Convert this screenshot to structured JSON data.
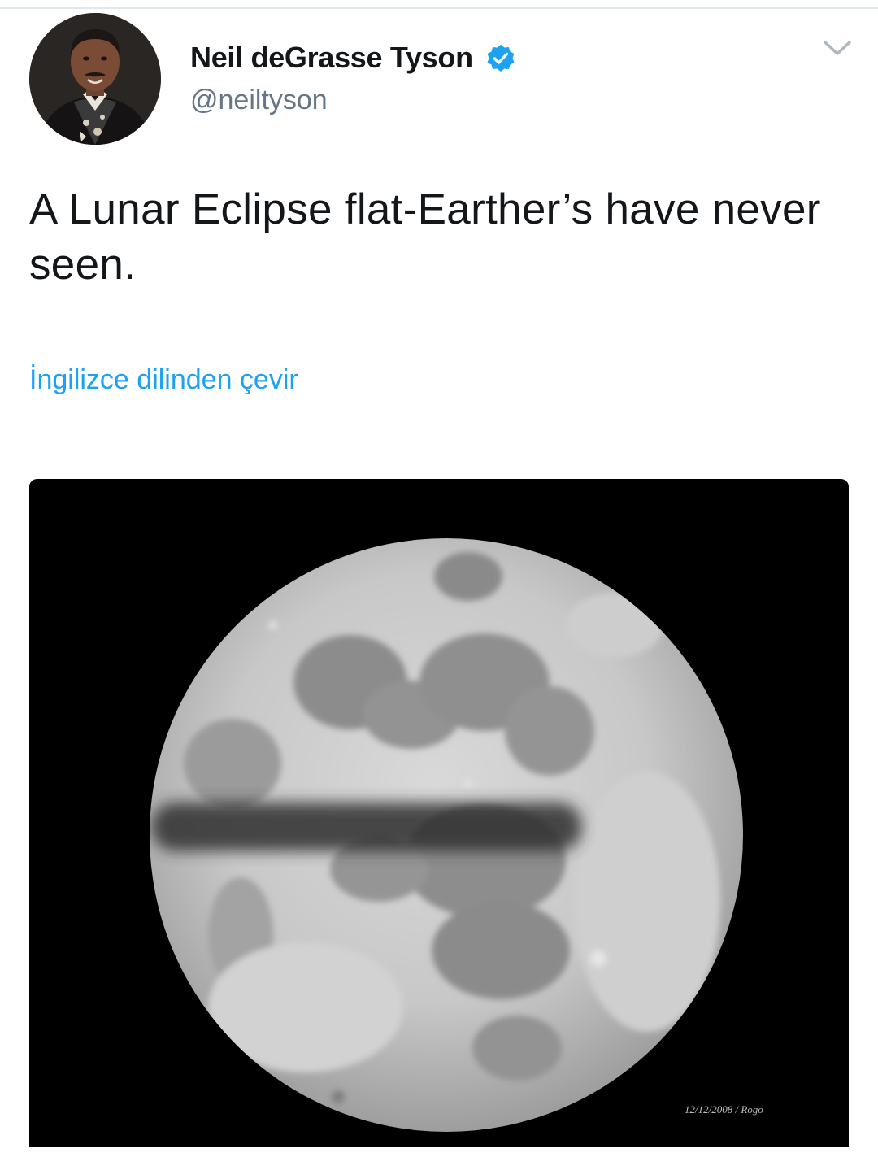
{
  "tweet": {
    "author": {
      "display_name": "Neil deGrasse Tyson",
      "handle": "@neiltyson",
      "verified": true
    },
    "text": "A Lunar Eclipse flat-Earther’s have never seen.",
    "translate_link": "İngilizce dilinden çevir",
    "media": {
      "watermark": "12/12/2008 / Rogo"
    }
  },
  "colors": {
    "link": "#1da1f2",
    "verified_badge": "#1da1f2",
    "secondary_text": "#657786",
    "primary_text": "#14171a",
    "chevron": "#aab8c2"
  },
  "icons": {
    "verified": "verified-badge-icon",
    "menu": "chevron-down-icon"
  }
}
